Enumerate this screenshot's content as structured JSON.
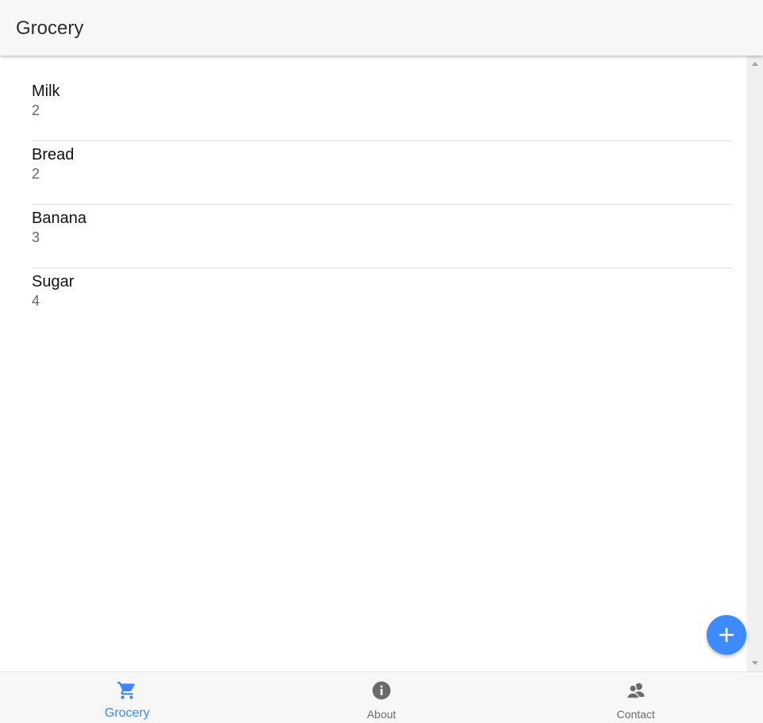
{
  "app": {
    "title": "Grocery"
  },
  "groceries": [
    {
      "name": "Milk",
      "quantity": "2"
    },
    {
      "name": "Bread",
      "quantity": "2"
    },
    {
      "name": "Banana",
      "quantity": "3"
    },
    {
      "name": "Sugar",
      "quantity": "4"
    }
  ],
  "fab": {
    "icon": "plus-icon",
    "color": "#3d8bfd"
  },
  "bottom_nav": {
    "active_color": "#4287f5",
    "inactive_color": "#6b6b6b",
    "tabs": [
      {
        "label": "Grocery",
        "icon": "shopping-cart-icon",
        "active": true
      },
      {
        "label": "About",
        "icon": "info-icon",
        "active": false
      },
      {
        "label": "Contact",
        "icon": "contacts-icon",
        "active": false
      }
    ]
  }
}
